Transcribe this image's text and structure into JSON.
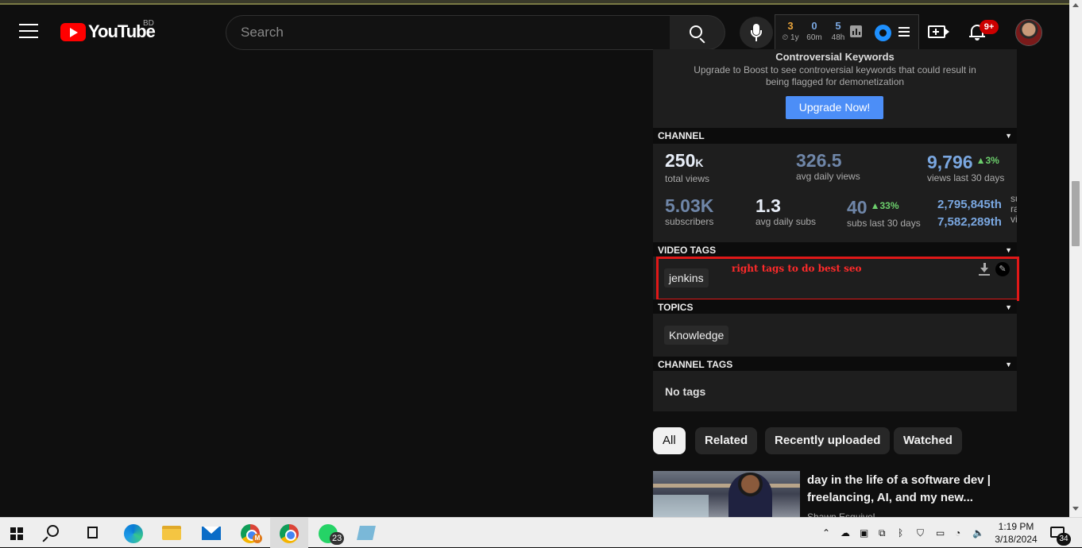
{
  "masthead": {
    "logo_text": "YouTube",
    "country_code": "BD",
    "search_placeholder": "Search",
    "notification_badge": "9+"
  },
  "vidiq": {
    "stats": [
      {
        "value": "3",
        "label": "1y",
        "color": "#e8a33a"
      },
      {
        "value": "0",
        "label": "60m",
        "color": "#7aa7e0"
      },
      {
        "value": "5",
        "label": "48h",
        "color": "#7aa7e0"
      }
    ]
  },
  "upsell": {
    "title": "Controversial Keywords",
    "description": "Upgrade to Boost to see controversial keywords that could result in being flagged for demonetization",
    "button": "Upgrade Now!"
  },
  "sections": {
    "channel": "CHANNEL",
    "video_tags": "VIDEO TAGS",
    "topics": "TOPICS",
    "channel_tags": "CHANNEL TAGS"
  },
  "channel_stats": {
    "total_views": {
      "value": "250",
      "suffix": "K",
      "label": "total views"
    },
    "avg_daily_views": {
      "value": "326.5",
      "label": "avg daily views"
    },
    "views_last_30": {
      "value": "9,796",
      "change": "▲3%",
      "label": "views last 30 days"
    },
    "subscribers": {
      "value": "5.03K",
      "label": "subscribers"
    },
    "avg_daily_subs": {
      "value": "1.3",
      "label": "avg daily subs"
    },
    "subs_last_30": {
      "value": "40",
      "change": "▲33%",
      "label": "subs last 30 days"
    },
    "ranks": [
      "2,795,845th",
      "7,582,289th"
    ],
    "rank_labels": [
      "su",
      "ra",
      "vi"
    ]
  },
  "video_tags": {
    "tags": [
      "jenkins"
    ],
    "annotation": "right tags to do best seo"
  },
  "topics": [
    "Knowledge"
  ],
  "channel_tags": {
    "empty_text": "No tags"
  },
  "filters": [
    "All",
    "Related",
    "Recently uploaded",
    "Watched"
  ],
  "recommended": {
    "title": "day in the life of a software dev | freelancing, AI, and my new...",
    "channel": "Shawn Esquivel"
  },
  "taskbar": {
    "whatsapp_badge": "23",
    "chrome_profile": "M",
    "time": "1:19 PM",
    "date": "3/18/2024",
    "notification_count": "34"
  },
  "colors": {
    "accent_blue": "#4c8ef7",
    "annotation_red": "#e01818",
    "youtube_red": "#ff0000",
    "growth_green": "#6ccf6c"
  }
}
